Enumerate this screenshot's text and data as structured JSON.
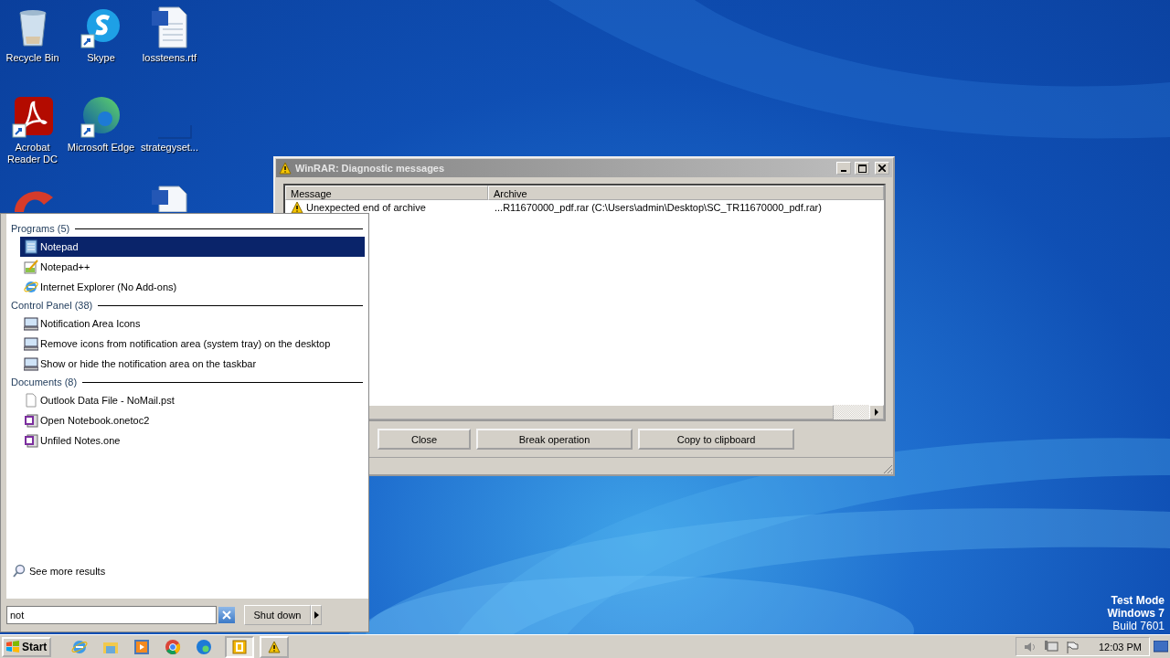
{
  "desktop_icons": [
    {
      "label": "Recycle Bin"
    },
    {
      "label": "Skype"
    },
    {
      "label": "lossteens.rtf"
    },
    {
      "label": "Acrobat Reader DC"
    },
    {
      "label": "Microsoft Edge"
    },
    {
      "label": "strategyset..."
    }
  ],
  "window": {
    "title": "WinRAR: Diagnostic messages",
    "columns": [
      "Message",
      "Archive"
    ],
    "rows": [
      {
        "message": "Unexpected end of archive",
        "archive": "...R11670000_pdf.rar (C:\\Users\\admin\\Desktop\\SC_TR11670000_pdf.rar)"
      }
    ],
    "buttons": [
      "Close",
      "Break operation",
      "Copy to clipboard"
    ]
  },
  "start_menu": {
    "groups": [
      {
        "title": "Programs (5)",
        "items": [
          {
            "label": "Notepad",
            "selected": true
          },
          {
            "label": "Notepad++",
            "selected": false
          },
          {
            "label": "Internet Explorer (No Add-ons)",
            "selected": false
          }
        ]
      },
      {
        "title": "Control Panel (38)",
        "items": [
          {
            "label": "Notification Area Icons",
            "selected": false
          },
          {
            "label": "Remove icons from notification area (system tray) on the desktop",
            "selected": false
          },
          {
            "label": "Show or hide the notification area on the taskbar",
            "selected": false
          }
        ]
      },
      {
        "title": "Documents (8)",
        "items": [
          {
            "label": "Outlook Data File - NoMail.pst",
            "selected": false
          },
          {
            "label": "Open Notebook.onetoc2",
            "selected": false
          },
          {
            "label": "Unfiled Notes.one",
            "selected": false
          }
        ]
      }
    ],
    "see_more": "See more results",
    "search": {
      "value": "not"
    },
    "shutdown": "Shut down"
  },
  "os_notice": [
    "Test Mode",
    "Windows 7",
    "Build 7601"
  ],
  "taskbar": {
    "start": "Start",
    "clock": "12:03 PM"
  }
}
